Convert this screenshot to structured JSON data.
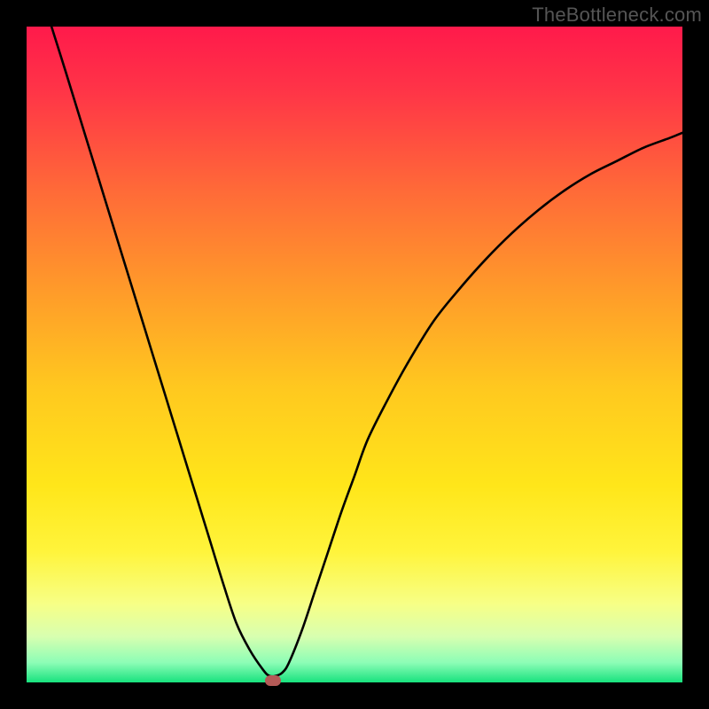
{
  "watermark": "TheBottleneck.com",
  "chart_data": {
    "type": "line",
    "title": "",
    "xlabel": "",
    "ylabel": "",
    "xlim": [
      0,
      100
    ],
    "ylim": [
      0,
      100
    ],
    "grid": false,
    "series": [
      {
        "name": "bottleneck-curve",
        "x": [
          3.8,
          6,
          8,
          10,
          12,
          14,
          16,
          18,
          20,
          22,
          24,
          26,
          28,
          30,
          32,
          34,
          36,
          37,
          38,
          39,
          40,
          42,
          44,
          46,
          48,
          50,
          52,
          55,
          58,
          62,
          66,
          70,
          74,
          78,
          82,
          86,
          90,
          94,
          98,
          100
        ],
        "y": [
          100,
          93,
          86.5,
          80,
          73.5,
          67,
          60.5,
          54,
          47.5,
          41,
          34.5,
          28,
          21.5,
          15,
          9,
          5,
          2,
          1,
          1,
          1.5,
          3,
          8,
          14,
          20,
          26,
          31.5,
          37,
          43,
          48.5,
          55,
          60,
          64.5,
          68.5,
          72,
          75,
          77.5,
          79.5,
          81.5,
          83,
          83.8
        ]
      }
    ],
    "marker": {
      "x": 37.5,
      "y": 0,
      "color": "#b45a57"
    },
    "colors": {
      "curve": "#000000",
      "gradient_top": "#ff1a4b",
      "gradient_bottom": "#18e27e"
    }
  }
}
